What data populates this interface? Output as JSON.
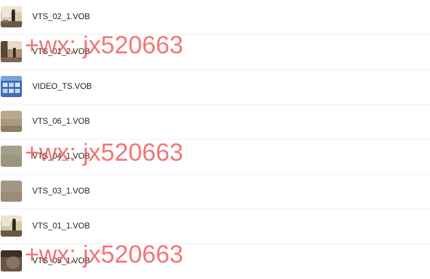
{
  "files": [
    {
      "name": "VTS_02_1.VOB",
      "thumbnail": "lecture-room-presenter"
    },
    {
      "name": "VTS_01_2.VOB",
      "thumbnail": "room-interior"
    },
    {
      "name": "VIDEO_TS.VOB",
      "thumbnail": "blue-menu-screen"
    },
    {
      "name": "VTS_06_1.VOB",
      "thumbnail": "blurred-beige"
    },
    {
      "name": "VTS_04_1.VOB",
      "thumbnail": "grey-green-texture"
    },
    {
      "name": "VTS_03_1.VOB",
      "thumbnail": "grey-brown-texture"
    },
    {
      "name": "VTS_01_1.VOB",
      "thumbnail": "lecture-room-presenter"
    },
    {
      "name": "VTS_05_1.VOB",
      "thumbnail": "dark-brown-closeup"
    }
  ],
  "watermark": {
    "text": "+wx: jx520663",
    "color": "#f05050"
  }
}
